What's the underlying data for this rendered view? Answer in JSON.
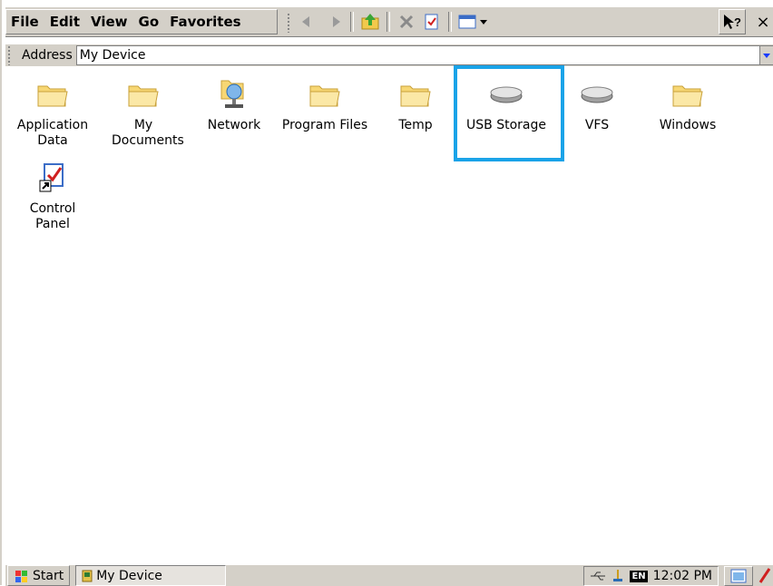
{
  "menu": [
    "File",
    "Edit",
    "View",
    "Go",
    "Favorites"
  ],
  "toolbar": {
    "icons": [
      "back-icon",
      "forward-icon",
      "up-folder-icon",
      "delete-icon",
      "properties-icon",
      "views-icon"
    ],
    "help_icon": "help-icon",
    "close_label": "×"
  },
  "address": {
    "label": "Address",
    "value": "My Device"
  },
  "items": [
    {
      "label": "Application Data",
      "icon": "folder-icon"
    },
    {
      "label": "My Documents",
      "icon": "folder-icon"
    },
    {
      "label": "Network",
      "icon": "network-icon"
    },
    {
      "label": "Program Files",
      "icon": "folder-icon"
    },
    {
      "label": "Temp",
      "icon": "folder-icon"
    },
    {
      "label": "USB Storage",
      "icon": "drive-icon"
    },
    {
      "label": "VFS",
      "icon": "drive-icon"
    },
    {
      "label": "Windows",
      "icon": "folder-icon"
    },
    {
      "label": "Control Panel",
      "icon": "control-panel-shortcut-icon"
    }
  ],
  "highlight_color": "#1aa3e8",
  "taskbar": {
    "start_label": "Start",
    "task_label": "My Device",
    "language": "EN",
    "time": "12:02 PM"
  }
}
